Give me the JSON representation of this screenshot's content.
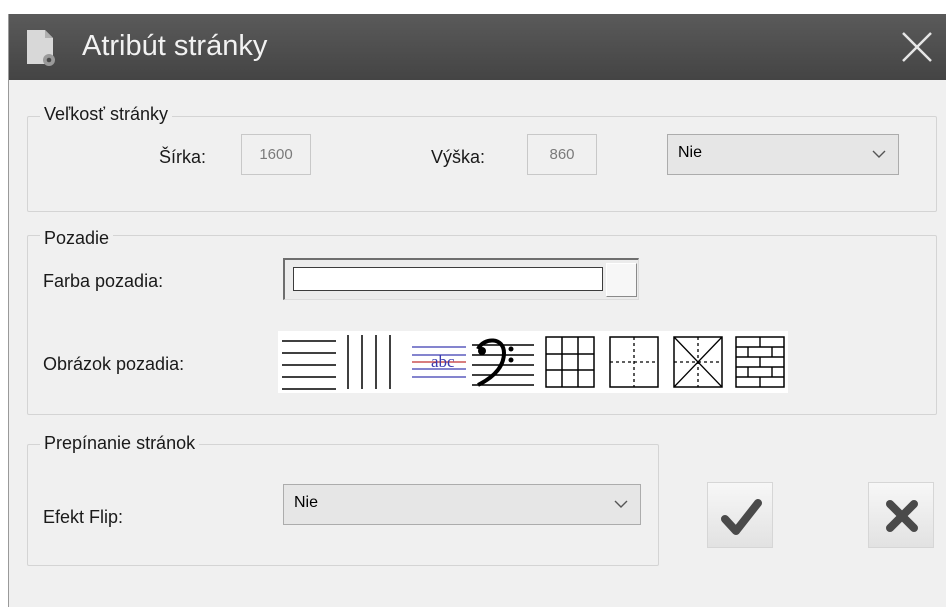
{
  "window": {
    "title": "Atribút stránky",
    "icon": "page-settings-icon",
    "close_icon": "close-icon"
  },
  "page_size": {
    "legend": "Veľkosť stránky",
    "width_label": "Šírka:",
    "width_value": "1600",
    "height_label": "Výška:",
    "height_value": "860",
    "preset_value": "Nie"
  },
  "background": {
    "legend": "Pozadie",
    "color_label": "Farba pozadia:",
    "color_value": "#ffffff",
    "image_label": "Obrázok pozadia:",
    "patterns": [
      "horizontal-lines-icon",
      "vertical-lines-icon",
      "handwriting-lines-icon",
      "bass-clef-staff-icon",
      "grid-icon",
      "dashed-cross-icon",
      "diagonal-cross-icon",
      "brick-icon"
    ]
  },
  "page_turn": {
    "legend": "Prepínanie stránok",
    "flip_label": "Efekt Flip:",
    "flip_value": "Nie"
  },
  "actions": {
    "ok_icon": "checkmark-icon",
    "cancel_icon": "cancel-x-icon"
  }
}
